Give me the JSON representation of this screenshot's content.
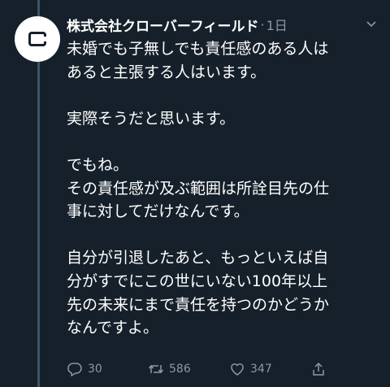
{
  "tweet": {
    "display_name": "株式会社クローバーフィールド",
    "separator": "·",
    "time": "1日",
    "body_lines": [
      "未婚でも子無しでも責任感のある人は",
      "あると主張する人はいます。",
      "",
      "実際そうだと思います。",
      "",
      "でもね。",
      "その責任感が及ぶ範囲は所詮目先の仕",
      "事に対してだけなんです。",
      "",
      "自分が引退したあと、もっといえば自",
      "分がすでにこの世にいない100年以上",
      "先の未来にまで責任を持つのかどうか",
      "なんですよ。"
    ],
    "actions": {
      "reply_count": "30",
      "retweet_count": "586",
      "like_count": "347"
    }
  },
  "colors": {
    "background": "#15202b",
    "text": "#ffffff",
    "muted": "#8899a6",
    "thread_line": "#3d5466"
  }
}
